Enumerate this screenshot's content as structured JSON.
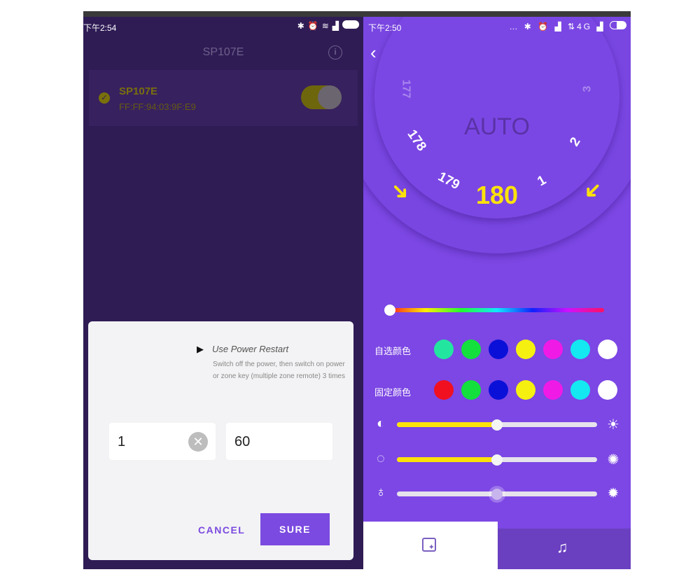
{
  "left_screen": {
    "status": {
      "time": "下午2:54",
      "icons": [
        "bluetooth-icon",
        "alarm-icon",
        "wifi-icon",
        "signal-icon",
        "signal-icon",
        "battery-icon"
      ]
    },
    "header": {
      "title": "SP107E",
      "info_icon": "info-icon"
    },
    "device": {
      "name": "SP107E",
      "mac": "FF:FF:94:03:9F:E9",
      "connected": true,
      "toggle_on": true
    },
    "dialog": {
      "heading": "Use Power Restart",
      "line1": "Switch off the power, then switch on power",
      "line2": "or zone key (multiple zone remote) 3 times",
      "input1": "1",
      "input2": "60",
      "cancel_label": "CANCEL",
      "sure_label": "SURE"
    }
  },
  "right_screen": {
    "status": {
      "time": "下午2:50",
      "network": "4G",
      "icons": [
        "more-icon",
        "bluetooth-icon",
        "alarm-icon",
        "signal-icon",
        "data-icon",
        "signal-icon",
        "battery-icon"
      ]
    },
    "dial": {
      "mode": "AUTO",
      "selected": "180",
      "numbers": [
        "177",
        "178",
        "179",
        "1",
        "2",
        "3"
      ]
    },
    "custom_colors_label": "自选颜色",
    "fixed_colors_label": "固定颜色",
    "custom_colors": [
      "#22e6a0",
      "#13e03c",
      "#0a10d8",
      "#f5f010",
      "#f01ae6",
      "#14e8f0",
      "#ffffff"
    ],
    "fixed_colors": [
      "#f01020",
      "#13e03c",
      "#0a10d8",
      "#f5f010",
      "#f01ae6",
      "#14e8f0",
      "#ffffff"
    ],
    "hue_slider": 0,
    "brightness": 50,
    "speed": 50,
    "white_level": 50,
    "accent": "#7c47e4",
    "highlight": "#fde20a"
  }
}
